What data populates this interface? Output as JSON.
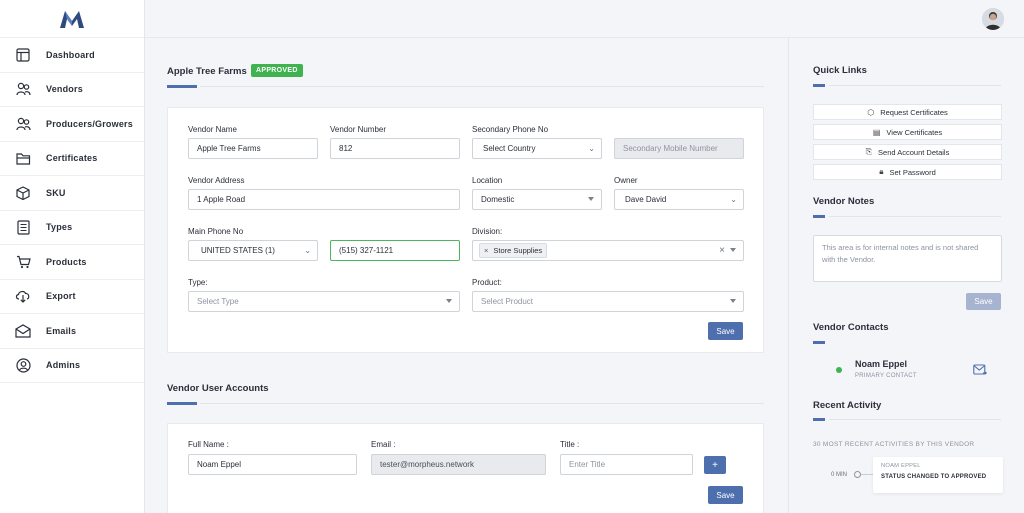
{
  "colors": {
    "accent": "#4e6fae",
    "approved": "#3eb34f",
    "online": "#3eb34f"
  },
  "sidebar": {
    "items": [
      {
        "label": "Dashboard",
        "icon": "layout-icon"
      },
      {
        "label": "Vendors",
        "icon": "users-icon"
      },
      {
        "label": "Producers/Growers",
        "icon": "users-icon"
      },
      {
        "label": "Certificates",
        "icon": "folder-icon"
      },
      {
        "label": "SKU",
        "icon": "box-icon"
      },
      {
        "label": "Types",
        "icon": "document-icon"
      },
      {
        "label": "Products",
        "icon": "cart-icon"
      },
      {
        "label": "Export",
        "icon": "download-cloud-icon"
      },
      {
        "label": "Emails",
        "icon": "envelope-icon"
      },
      {
        "label": "Admins",
        "icon": "user-circle-icon"
      }
    ]
  },
  "vendor": {
    "name_title": "Apple Tree Farms",
    "status": "APPROVED",
    "fields": {
      "vendor_name_label": "Vendor Name",
      "vendor_name_value": "Apple Tree Farms",
      "vendor_number_label": "Vendor Number",
      "vendor_number_value": "812",
      "secondary_phone_label": "Secondary Phone No",
      "secondary_country_placeholder": "Select Country",
      "secondary_mobile_placeholder": "Secondary Mobile Number",
      "address_label": "Vendor Address",
      "address_value": "1 Apple Road",
      "location_label": "Location",
      "location_value": "Domestic",
      "owner_label": "Owner",
      "owner_value": "Dave David",
      "main_phone_label": "Main Phone No",
      "main_country_value": "UNITED STATES (1)",
      "main_phone_value": "(515) 327-1121",
      "division_label": "Division:",
      "division_tag": "Store Supplies",
      "type_label": "Type:",
      "type_placeholder": "Select Type",
      "product_label": "Product:",
      "product_placeholder": "Select Product"
    },
    "save_label": "Save"
  },
  "user_accounts": {
    "title": "Vendor User Accounts",
    "full_name_label": "Full Name :",
    "full_name_value": "Noam Eppel",
    "email_label": "Email :",
    "email_value": "tester@morpheus.network",
    "title_label": "Title :",
    "title_placeholder": "Enter Title",
    "add_label": "+",
    "save_label": "Save"
  },
  "right_panel": {
    "quick_links_title": "Quick Links",
    "quick_links": [
      {
        "label": "Request Certificates",
        "icon": "cube-icon"
      },
      {
        "label": "View Certificates",
        "icon": "certificate-icon"
      },
      {
        "label": "Send Account Details",
        "icon": "send-icon"
      },
      {
        "label": "Set Password",
        "icon": "lock-icon"
      }
    ],
    "notes_title": "Vendor Notes",
    "notes_placeholder": "This area is for internal notes and is not shared with the Vendor.",
    "notes_save": "Save",
    "contacts_title": "Vendor Contacts",
    "contact_name": "Noam Eppel",
    "contact_role": "PRIMARY CONTACT",
    "activity_title": "Recent Activity",
    "activity_subtitle": "30 MOST RECENT ACTIVITIES BY THIS VENDOR",
    "activity_time": "0 MIN",
    "activity_user": "NOAM EPPEL",
    "activity_text": "STATUS CHANGED TO APPROVED"
  }
}
